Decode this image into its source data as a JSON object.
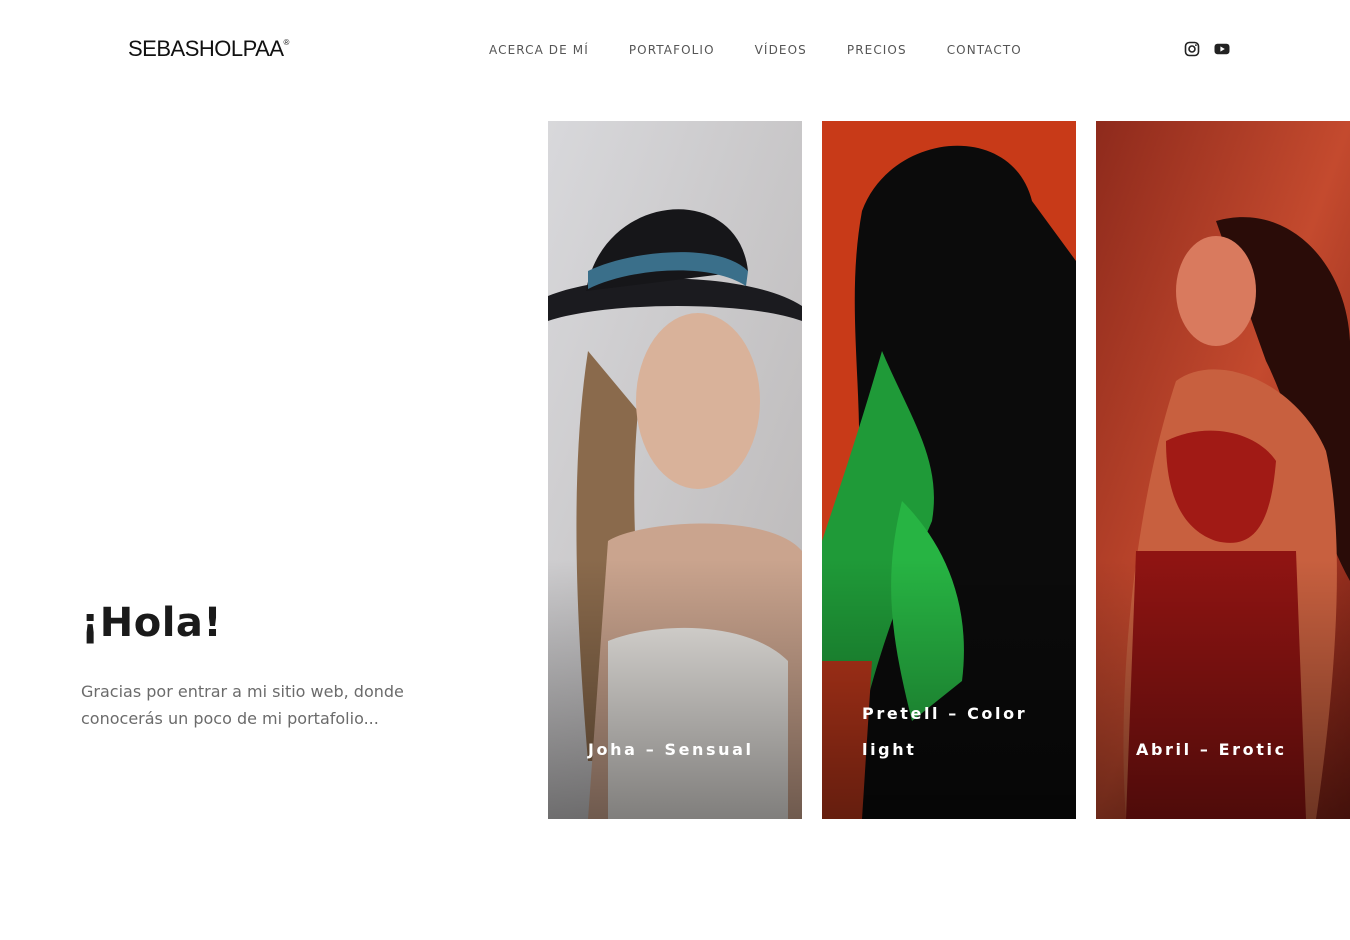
{
  "header": {
    "logo": "SEBASHOLPAA",
    "logo_mark": "®",
    "nav": [
      "ACERCA DE MÍ",
      "PORTAFOLIO",
      "VÍDEOS",
      "PRECIOS",
      "CONTACTO"
    ],
    "social_icons": [
      "instagram-icon",
      "youtube-icon"
    ]
  },
  "hero": {
    "title": "¡Hola!",
    "text": "Gracias por entrar a mi sitio web, donde conocerás un poco de mi portafolio..."
  },
  "gallery": [
    {
      "caption": "Joha – Sensual",
      "colors": [
        "#cfcfd2",
        "#9c8d84"
      ]
    },
    {
      "caption": "Pretell – Color light",
      "colors": [
        "#d6401c",
        "#1fa83a"
      ]
    },
    {
      "caption": "Abril – Erotic",
      "colors": [
        "#c9452c",
        "#5a140e"
      ]
    }
  ]
}
